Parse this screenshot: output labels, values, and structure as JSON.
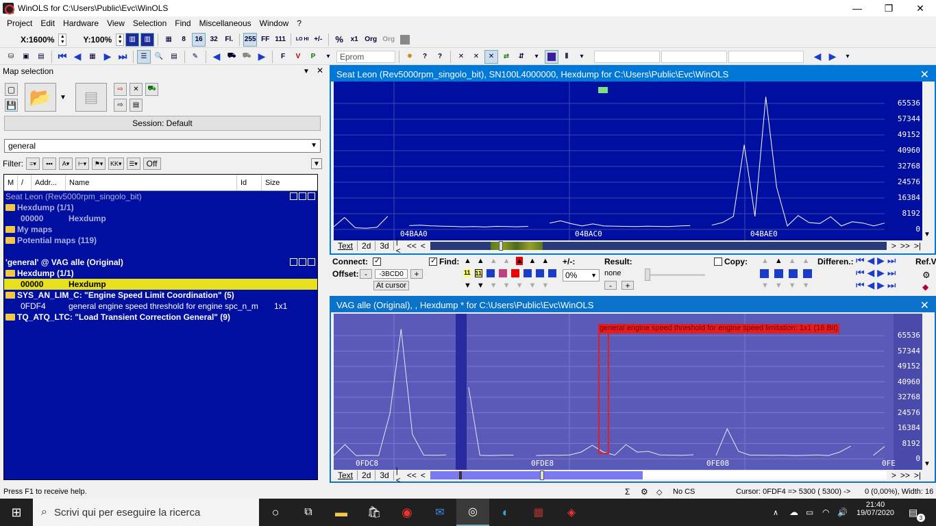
{
  "window": {
    "title": "WinOLS for C:\\Users\\Public\\Evc\\WinOLS",
    "minimize": "—",
    "maximize": "❐",
    "close": "✕"
  },
  "menu": [
    "Project",
    "Edit",
    "Hardware",
    "View",
    "Selection",
    "Find",
    "Miscellaneous",
    "Window",
    "?"
  ],
  "toolbar1": {
    "zoom_x": "X:1600%",
    "zoom_y": "Y:100%",
    "btn_8": "8",
    "btn_16": "16",
    "btn_32": "32",
    "btn_fl": "Fl.",
    "btn_255": "255",
    "btn_ff": "FF",
    "btn_111": "111",
    "btn_lohi": "LO HI",
    "btn_hilo": "HILO",
    "btn_pm": "+/-",
    "btn_pct": "%",
    "btn_x1": "x1",
    "btn_org": "Org",
    "btn_org2": "Org"
  },
  "toolbar2": {
    "eprom": "Eprom"
  },
  "left_panel": {
    "title": "Map selection",
    "pin": "▼",
    "close": "✕",
    "session": "Session: Default",
    "search_value": "general",
    "filter_label": "Filter:",
    "filter_off": "Off",
    "columns": [
      "M",
      "/",
      "Addr...",
      "Name",
      "Id",
      "Size"
    ],
    "rows": [
      {
        "text": "Seat Leon (Rev5000rpm_singolo_bit)",
        "kind": "project-dim"
      },
      {
        "text": "Hexdump (1/1)",
        "kind": "folder-dim"
      },
      {
        "addr": "00000",
        "name": "Hexdump",
        "kind": "entry-dim"
      },
      {
        "text": "My maps",
        "kind": "folder-dim"
      },
      {
        "text": "Potential maps (119)",
        "kind": "folder-dim"
      },
      {
        "text": "",
        "kind": "blank"
      },
      {
        "text": "'general' @ VAG  alle (Original)",
        "kind": "project"
      },
      {
        "text": "Hexdump (1/1)",
        "kind": "folder"
      },
      {
        "addr": "00000",
        "name": "Hexdump",
        "kind": "entry-selected"
      },
      {
        "text": "SYS_AN_LIM_C: \"Engine Speed Limit Coordination\" (5)",
        "kind": "folder"
      },
      {
        "addr": "0FDF4",
        "name": "general engine speed threshold for engine spc_n_m",
        "size": "1x1",
        "kind": "entry"
      },
      {
        "text": "TQ_ATQ_LTC: \"Load Transient Correction General\" (9)",
        "kind": "folder"
      }
    ]
  },
  "top_graph": {
    "title": "Seat Leon (Rev5000rpm_singolo_bit), SN100L4000000, Hexdump for C:\\Users\\Public\\Evc\\WinOLS",
    "close": "✕",
    "y_ticks": [
      "65536",
      "57344",
      "49152",
      "40960",
      "32768",
      "24576",
      "16384",
      "8192",
      "0"
    ],
    "x_labels": [
      "04BAA0",
      "04BAC0",
      "04BAE0"
    ],
    "tabs": [
      "Text",
      "2d",
      "3d",
      "|<",
      "<<",
      "<"
    ],
    "tabs_right": [
      ">",
      ">>",
      ">|"
    ],
    "series": [
      1400,
      6200,
      900,
      600,
      1100,
      6800,
      null,
      2000,
      2200,
      1900,
      1700,
      1600,
      1400,
      1500,
      1300,
      1600,
      1500,
      1400,
      1600,
      null,
      3300,
      4500,
      3000,
      1800,
      2900,
      1800,
      1700,
      1600,
      1500,
      1700,
      1600,
      1500,
      1800,
      2000,
      null,
      2200,
      3600,
      6800,
      44000,
      6800,
      69000,
      22000,
      1800,
      7200,
      3600,
      3100,
      6600,
      1800,
      4000,
      3300,
      1800,
      3300
    ]
  },
  "control_panel": {
    "connect_label": "Connect:",
    "offset_label": "Offset:",
    "offset_minus": "-",
    "offset_value": "-3BCD0",
    "offset_plus": "+",
    "at_cursor": "At cursor",
    "find_label": "Find:",
    "find_11a": "11",
    "find_11b": "11",
    "plusminus_label": "+/-:",
    "percent_value": "0%",
    "result_label": "Result:",
    "result_value": "none",
    "result_minus": "-",
    "result_plus": "+",
    "copy_label": "Copy:",
    "differen_label": "Differen.:",
    "ref_label": "Ref.V"
  },
  "bottom_graph": {
    "title": "VAG  alle (Original), , Hexdump * for C:\\Users\\Public\\Evc\\WinOLS",
    "close": "✕",
    "tooltip": "general engine speed threshold for engine speed limitation: 1x1 (16 Bit)",
    "y_ticks": [
      "65536",
      "57344",
      "49152",
      "40960",
      "32768",
      "24576",
      "16384",
      "8192",
      "0"
    ],
    "x_labels": [
      "0FDC8",
      "0FDE8",
      "0FE08",
      "0FE"
    ],
    "tabs": [
      "Text",
      "2d",
      "3d",
      "|<",
      "<<",
      "<"
    ],
    "tabs_right": [
      ">",
      ">>",
      ">|"
    ],
    "series": [
      1800,
      7600,
      1700,
      1900,
      1700,
      24000,
      69000,
      13000,
      2000,
      1900,
      2100,
      null,
      38000,
      1900,
      1800,
      2000,
      2000,
      null,
      1800,
      2000,
      1900,
      2100,
      3600,
      7200,
      3600,
      2000,
      7600,
      3600,
      4000,
      2100,
      2000,
      1900,
      2200,
      null,
      1800,
      16000,
      4000,
      2000,
      2000,
      1900,
      2000,
      1800,
      1900,
      2100,
      1800,
      3600,
      6800,
      null,
      1900,
      6600
    ]
  },
  "status": {
    "help": "Press F1 to receive help.",
    "cs": "No CS",
    "cursor": "Cursor: 0FDF4 =>   5300 ( 5300) ->",
    "width": "0 (0,00%), Width: 16"
  },
  "taskbar": {
    "search_placeholder": "Scrivi qui per eseguire la ricerca",
    "time": "21:40",
    "date": "19/07/2020",
    "notif": "3"
  },
  "colors": {
    "graph_bg_top": "#000f9f",
    "graph_bg_bottom": "#5a5ab8",
    "selection": "#e6e01e",
    "tooltip_red": "#e41d1d"
  }
}
